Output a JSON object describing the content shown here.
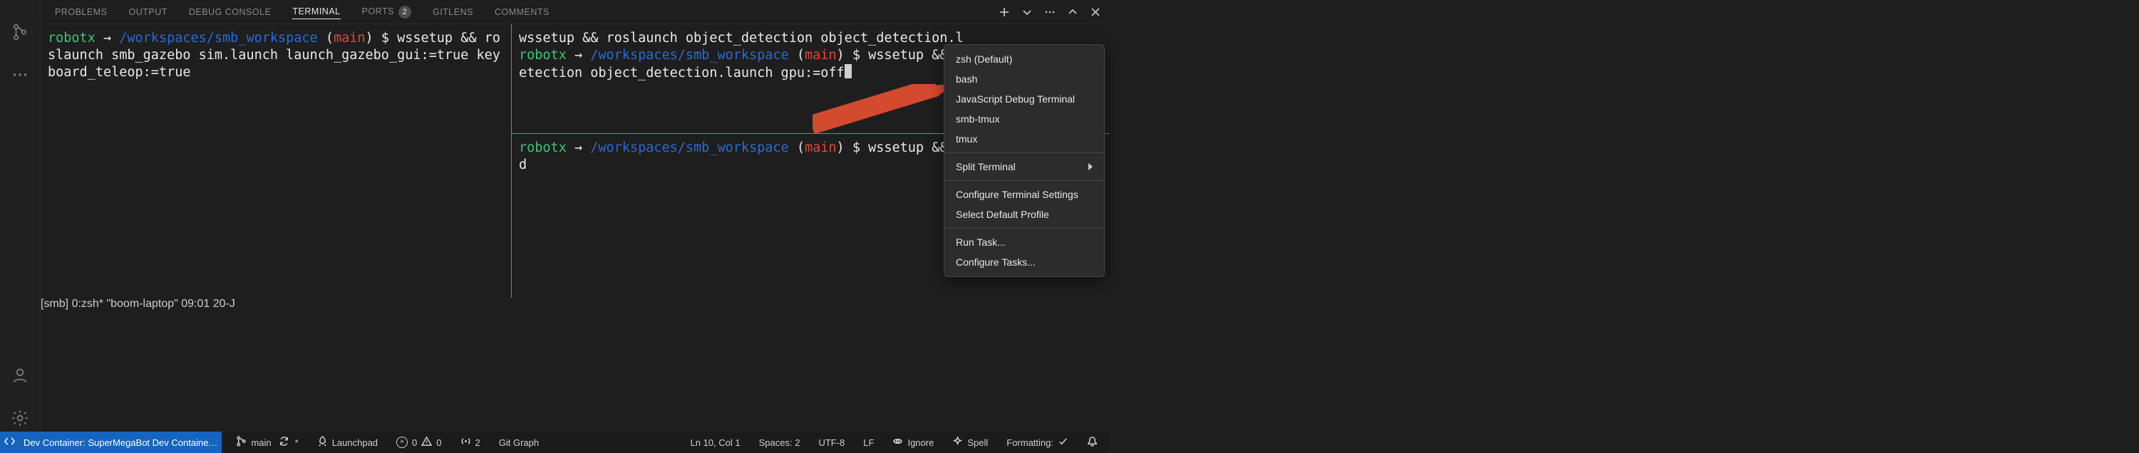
{
  "panel": {
    "tabs": [
      {
        "label": "PROBLEMS"
      },
      {
        "label": "OUTPUT"
      },
      {
        "label": "DEBUG CONSOLE"
      },
      {
        "label": "TERMINAL",
        "active": true
      },
      {
        "label": "PORTS",
        "badge": "2"
      },
      {
        "label": "GITLENS"
      },
      {
        "label": "COMMENTS"
      }
    ],
    "actions": {
      "new_terminal": "+",
      "split_chevron": "⌄",
      "overflow": "···",
      "maximize": "^",
      "close": "×"
    }
  },
  "terminals": {
    "left": {
      "prompt": {
        "user": "robotx",
        "arrow": "→",
        "path": "/workspaces/smb_workspace",
        "branch": "main",
        "sigil": "$"
      },
      "command": "wssetup && roslaunch smb_gazebo sim.launch launch_gazebo_gui:=true keyboard_teleop:=true"
    },
    "right_upper": {
      "raw_line": "wssetup && roslaunch object_detection object_detection.l",
      "prompt": {
        "user": "robotx",
        "arrow": "→",
        "path": "/workspaces/smb_workspace",
        "branch": "main",
        "sigil": "$"
      },
      "command": "wssetup && roslaunch object_detection object_detection.launch gpu:=off"
    },
    "right_lower": {
      "prompt": {
        "user": "robotx",
        "arrow": "→",
        "path": "/workspaces/smb_workspace",
        "branch": "main",
        "sigil": "$"
      },
      "command": "wssetup && cd"
    },
    "tmux": {
      "left": "[smb] 0:zsh*",
      "right": "\"boom-laptop\" 09:01 20-J"
    }
  },
  "menu": {
    "items": [
      {
        "label": "zsh (Default)"
      },
      {
        "label": "bash"
      },
      {
        "label": "JavaScript Debug Terminal"
      },
      {
        "label": "smb-tmux"
      },
      {
        "label": "tmux"
      },
      {
        "sep": true
      },
      {
        "label": "Split Terminal",
        "submenu": true
      },
      {
        "sep": true
      },
      {
        "label": "Configure Terminal Settings"
      },
      {
        "label": "Select Default Profile"
      },
      {
        "sep": true
      },
      {
        "label": "Run Task..."
      },
      {
        "label": "Configure Tasks..."
      }
    ]
  },
  "statusbar": {
    "remote": "Dev Container: SuperMegaBot Dev Containe…",
    "branch": {
      "icon": "branch",
      "name": "main",
      "sync": "sync"
    },
    "launchpad": "Launchpad",
    "diagnostics": {
      "errors": "0",
      "warnings": "0"
    },
    "ports": "2",
    "gitgraph": "Git Graph",
    "cursor": "Ln 10, Col 1",
    "spaces": "Spaces: 2",
    "encoding": "UTF-8",
    "eol": "LF",
    "gitignore": "Ignore",
    "spell": "Spell",
    "formatting": "Formatting:",
    "prettier": "✓"
  }
}
